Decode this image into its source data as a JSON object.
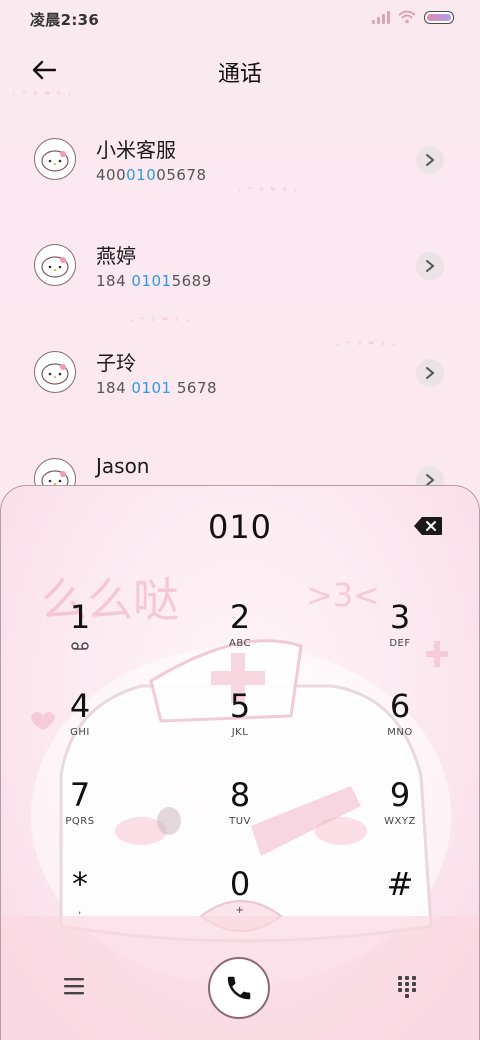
{
  "status": {
    "time": "凌晨2:36"
  },
  "header": {
    "title": "通话"
  },
  "contacts": [
    {
      "name": "小米客服",
      "num_pre": "400",
      "num_hl": "010",
      "num_post": "05678"
    },
    {
      "name": "燕婷",
      "num_pre": "184 ",
      "num_hl": "0101",
      "num_post": "5689"
    },
    {
      "name": "子玲",
      "num_pre": "184 ",
      "num_hl": "0101",
      "num_post": " 5678"
    },
    {
      "name": "Jason"
    }
  ],
  "dialer": {
    "input": "010",
    "keys": [
      {
        "digit": "1",
        "letters": ""
      },
      {
        "digit": "2",
        "letters": "ABC"
      },
      {
        "digit": "3",
        "letters": "DEF"
      },
      {
        "digit": "4",
        "letters": "GHI"
      },
      {
        "digit": "5",
        "letters": "JKL"
      },
      {
        "digit": "6",
        "letters": "MNO"
      },
      {
        "digit": "7",
        "letters": "PQRS"
      },
      {
        "digit": "8",
        "letters": "TUV"
      },
      {
        "digit": "9",
        "letters": "WXYZ"
      },
      {
        "digit": "*",
        "letters": ","
      },
      {
        "digit": "0",
        "letters": "+"
      },
      {
        "digit": "#",
        "letters": ""
      }
    ]
  },
  "wallpaper": {
    "text1": "么么哒",
    "text2": ">3<"
  },
  "icons": {
    "back": "arrow-left-icon",
    "chevron": "chevron-right-icon",
    "backspace": "backspace-icon",
    "voicemail": "voicemail-icon",
    "menu": "menu-icon",
    "call": "phone-icon",
    "dialpad": "dialpad-grid-icon"
  },
  "colors": {
    "highlight": "#2b9ce3",
    "accent_pink": "#f4b8c9"
  }
}
